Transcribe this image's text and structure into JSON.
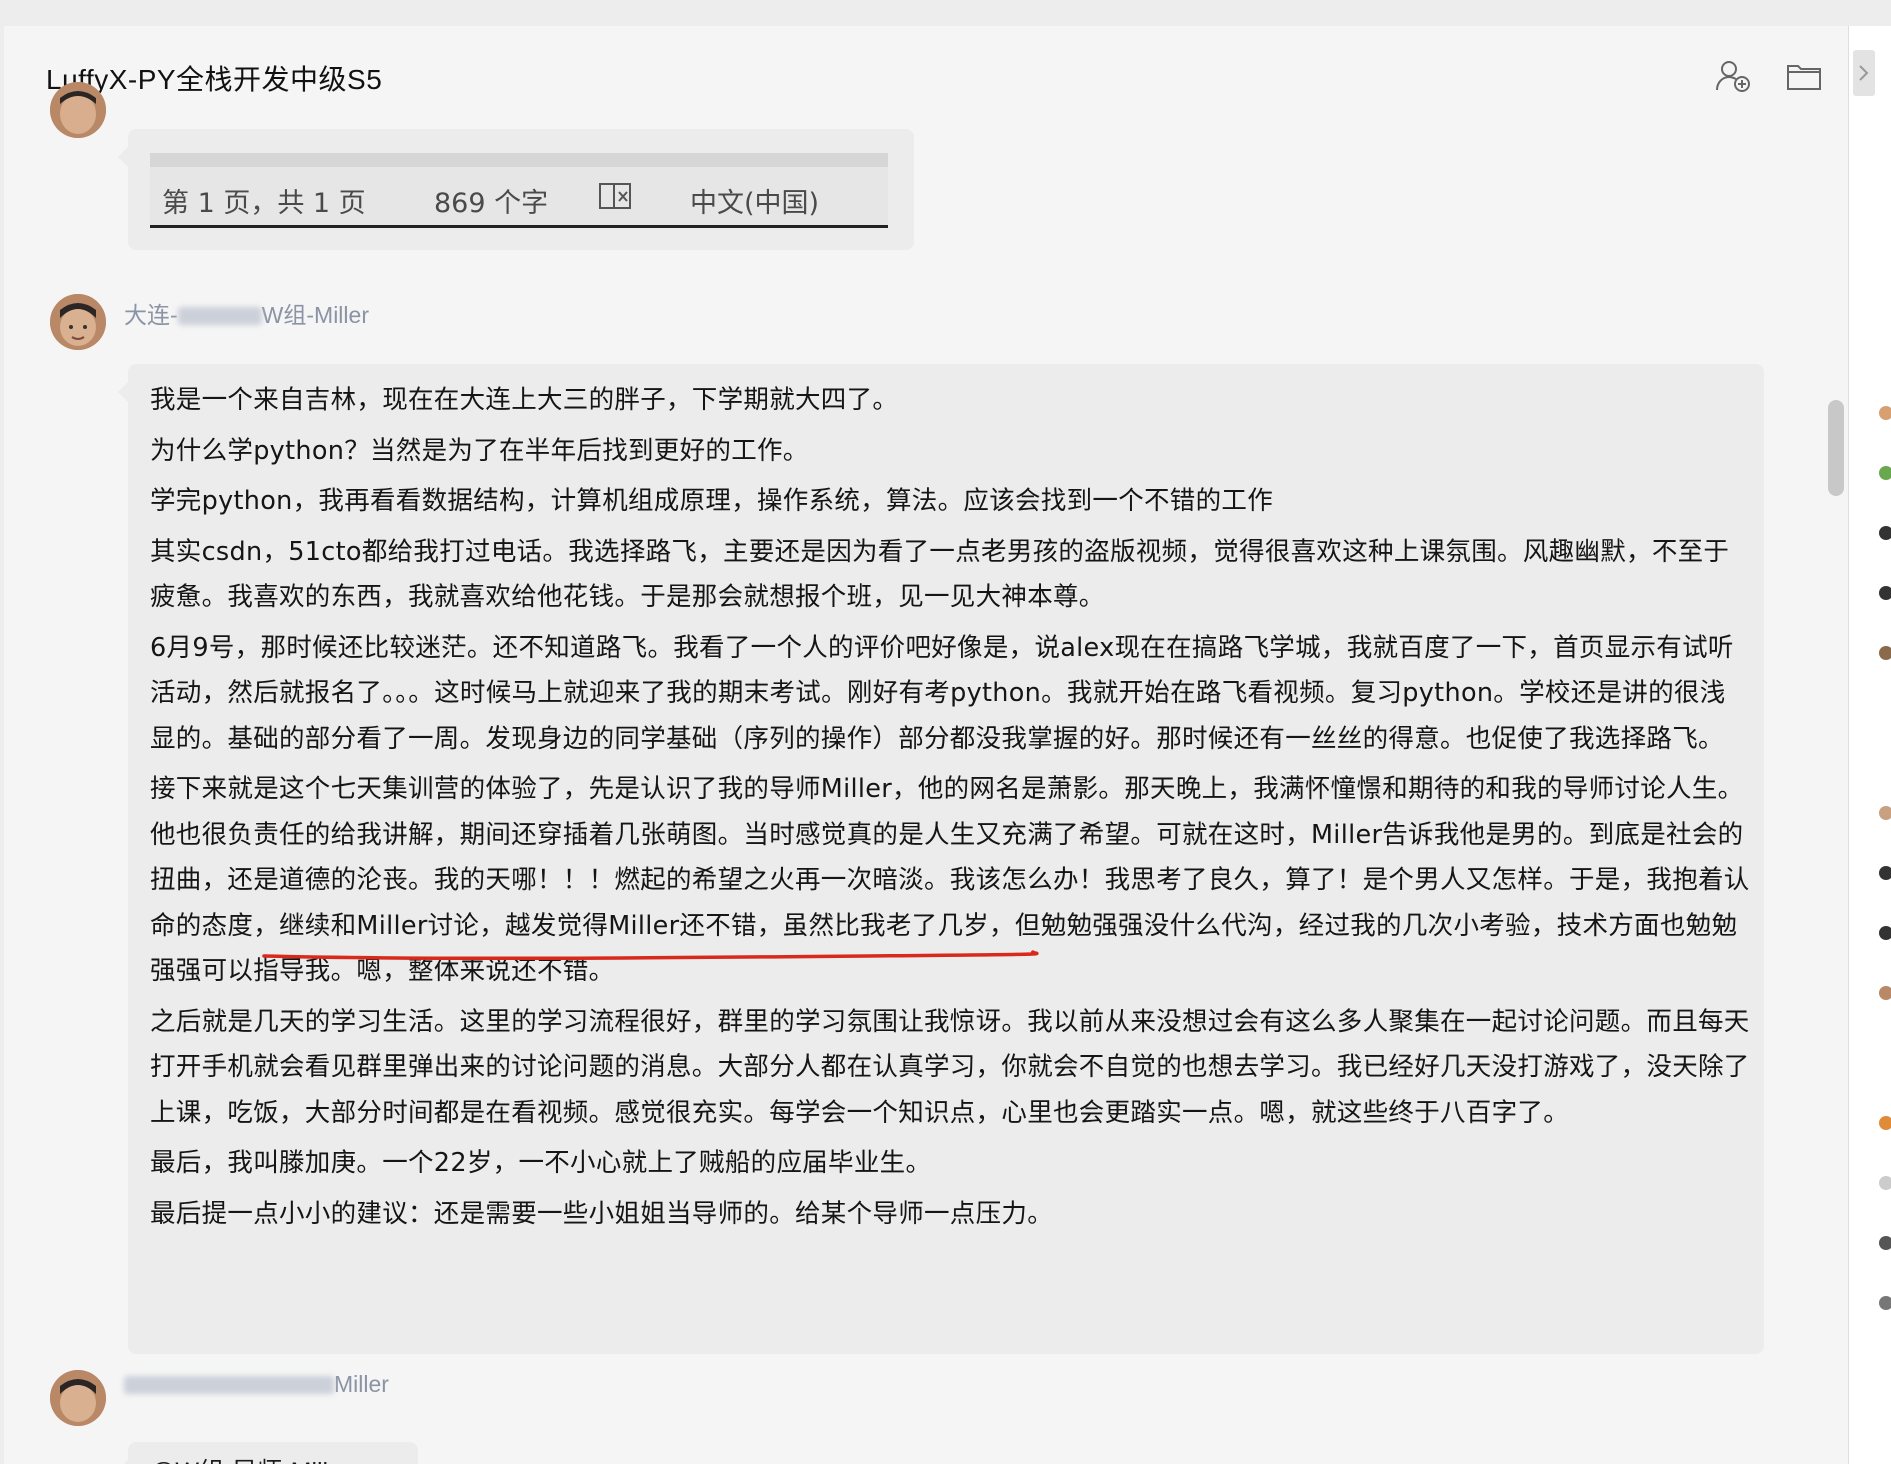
{
  "chat": {
    "title": "LuffyX-PY全栈开发中级S5",
    "header_icons": [
      "add-member-icon",
      "folder-icon"
    ]
  },
  "image_message": {
    "word_status": {
      "page": "第 1 页，共 1 页",
      "word_count": "869 个字",
      "language": "中文(中国)"
    }
  },
  "main_message": {
    "sender": {
      "prefix": "大连-",
      "suffix": "W组-Miller"
    },
    "paragraphs": [
      "我是一个来自吉林，现在在大连上大三的胖子，下学期就大四了。",
      "为什么学python？当然是为了在半年后找到更好的工作。",
      "学完python，我再看看数据结构，计算机组成原理，操作系统，算法。应该会找到一个不错的工作",
      "其实csdn，51cto都给我打过电话。我选择路飞，主要还是因为看了一点老男孩的盗版视频，觉得很喜欢这种上课氛围。风趣幽默，不至于疲惫。我喜欢的东西，我就喜欢给他花钱。于是那会就想报个班，见一见大神本尊。",
      "6月9号，那时候还比较迷茫。还不知道路飞。我看了一个人的评价吧好像是，说alex现在在搞路飞学城，我就百度了一下，首页显示有试听活动，然后就报名了。。。这时候马上就迎来了我的期末考试。刚好有考python。我就开始在路飞看视频。复习python。学校还是讲的很浅显的。基础的部分看了一周。发现身边的同学基础（序列的操作）部分都没我掌握的好。那时候还有一丝丝的得意。也促使了我选择路飞。",
      "接下来就是这个七天集训营的体验了，先是认识了我的导师Miller，他的网名是萧影。那天晚上，我满怀憧憬和期待的和我的导师讨论人生。他也很负责任的给我讲解，期间还穿插着几张萌图。当时感觉真的是人生又充满了希望。可就在这时，Miller告诉我他是男的。到底是社会的扭曲，还是道德的沦丧。我的天哪！！！燃起的希望之火再一次暗淡。我该怎么办！我思考了良久，算了！是个男人又怎样。于是，我抱着认命的态度，继续和Miller讨论，越发觉得Miller还不错，虽然比我老了几岁，但勉勉强强没什么代沟，经过我的几次小考验，技术方面也勉勉强强可以指导我。嗯，整体来说还不错。",
      "之后就是几天的学习生活。这里的学习流程很好，群里的学习氛围让我惊讶。我以前从来没想过会有这么多人聚集在一起讨论问题。而且每天打开手机就会看见群里弹出来的讨论问题的消息。大部分人都在认真学习，你就会不自觉的也想去学习。我已经好几天没打游戏了，没天除了上课，吃饭，大部分时间都是在看视频。感觉很充实。每学会一个知识点，心里也会更踏实一点。嗯，就这些终于八百字了。",
      "最后，我叫滕加庚。一个22岁，一不小心就上了贼船的应届毕业生。",
      "最后提一点小小的建议：还是需要一些小姐姐当导师的。给某个导师一点压力。"
    ],
    "highlight_color": "#d9291c"
  },
  "third_message": {
    "sender_suffix": "Miller",
    "text": "@W组-导师-Miller"
  },
  "colors": {
    "window_bg": "#f5f5f5",
    "bubble_bg": "#ececec",
    "sender_name": "#8b94a5"
  }
}
